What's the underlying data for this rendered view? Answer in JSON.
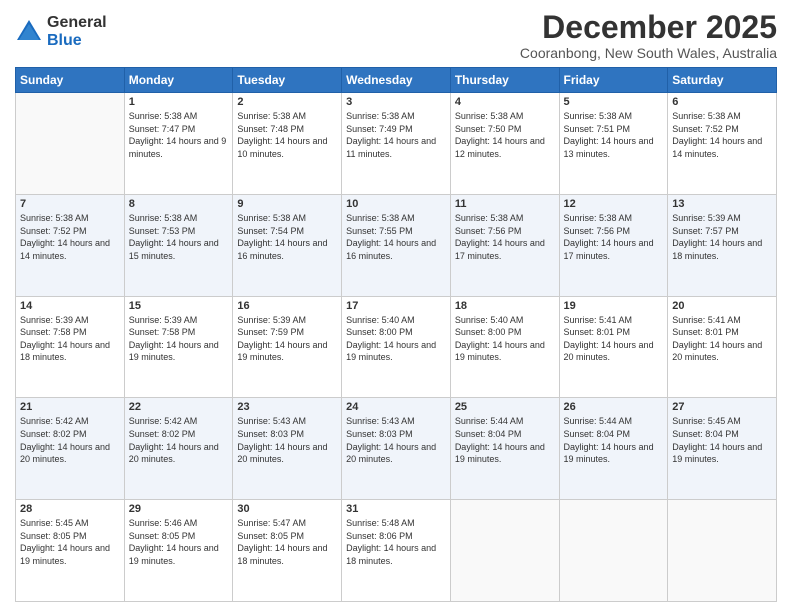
{
  "logo": {
    "general": "General",
    "blue": "Blue"
  },
  "header": {
    "month": "December 2025",
    "location": "Cooranbong, New South Wales, Australia"
  },
  "days_of_week": [
    "Sunday",
    "Monday",
    "Tuesday",
    "Wednesday",
    "Thursday",
    "Friday",
    "Saturday"
  ],
  "weeks": [
    [
      {
        "day": "",
        "sunrise": "",
        "sunset": "",
        "daylight": ""
      },
      {
        "day": "1",
        "sunrise": "Sunrise: 5:38 AM",
        "sunset": "Sunset: 7:47 PM",
        "daylight": "Daylight: 14 hours and 9 minutes."
      },
      {
        "day": "2",
        "sunrise": "Sunrise: 5:38 AM",
        "sunset": "Sunset: 7:48 PM",
        "daylight": "Daylight: 14 hours and 10 minutes."
      },
      {
        "day": "3",
        "sunrise": "Sunrise: 5:38 AM",
        "sunset": "Sunset: 7:49 PM",
        "daylight": "Daylight: 14 hours and 11 minutes."
      },
      {
        "day": "4",
        "sunrise": "Sunrise: 5:38 AM",
        "sunset": "Sunset: 7:50 PM",
        "daylight": "Daylight: 14 hours and 12 minutes."
      },
      {
        "day": "5",
        "sunrise": "Sunrise: 5:38 AM",
        "sunset": "Sunset: 7:51 PM",
        "daylight": "Daylight: 14 hours and 13 minutes."
      },
      {
        "day": "6",
        "sunrise": "Sunrise: 5:38 AM",
        "sunset": "Sunset: 7:52 PM",
        "daylight": "Daylight: 14 hours and 14 minutes."
      }
    ],
    [
      {
        "day": "7",
        "sunrise": "Sunrise: 5:38 AM",
        "sunset": "Sunset: 7:52 PM",
        "daylight": "Daylight: 14 hours and 14 minutes."
      },
      {
        "day": "8",
        "sunrise": "Sunrise: 5:38 AM",
        "sunset": "Sunset: 7:53 PM",
        "daylight": "Daylight: 14 hours and 15 minutes."
      },
      {
        "day": "9",
        "sunrise": "Sunrise: 5:38 AM",
        "sunset": "Sunset: 7:54 PM",
        "daylight": "Daylight: 14 hours and 16 minutes."
      },
      {
        "day": "10",
        "sunrise": "Sunrise: 5:38 AM",
        "sunset": "Sunset: 7:55 PM",
        "daylight": "Daylight: 14 hours and 16 minutes."
      },
      {
        "day": "11",
        "sunrise": "Sunrise: 5:38 AM",
        "sunset": "Sunset: 7:56 PM",
        "daylight": "Daylight: 14 hours and 17 minutes."
      },
      {
        "day": "12",
        "sunrise": "Sunrise: 5:38 AM",
        "sunset": "Sunset: 7:56 PM",
        "daylight": "Daylight: 14 hours and 17 minutes."
      },
      {
        "day": "13",
        "sunrise": "Sunrise: 5:39 AM",
        "sunset": "Sunset: 7:57 PM",
        "daylight": "Daylight: 14 hours and 18 minutes."
      }
    ],
    [
      {
        "day": "14",
        "sunrise": "Sunrise: 5:39 AM",
        "sunset": "Sunset: 7:58 PM",
        "daylight": "Daylight: 14 hours and 18 minutes."
      },
      {
        "day": "15",
        "sunrise": "Sunrise: 5:39 AM",
        "sunset": "Sunset: 7:58 PM",
        "daylight": "Daylight: 14 hours and 19 minutes."
      },
      {
        "day": "16",
        "sunrise": "Sunrise: 5:39 AM",
        "sunset": "Sunset: 7:59 PM",
        "daylight": "Daylight: 14 hours and 19 minutes."
      },
      {
        "day": "17",
        "sunrise": "Sunrise: 5:40 AM",
        "sunset": "Sunset: 8:00 PM",
        "daylight": "Daylight: 14 hours and 19 minutes."
      },
      {
        "day": "18",
        "sunrise": "Sunrise: 5:40 AM",
        "sunset": "Sunset: 8:00 PM",
        "daylight": "Daylight: 14 hours and 19 minutes."
      },
      {
        "day": "19",
        "sunrise": "Sunrise: 5:41 AM",
        "sunset": "Sunset: 8:01 PM",
        "daylight": "Daylight: 14 hours and 20 minutes."
      },
      {
        "day": "20",
        "sunrise": "Sunrise: 5:41 AM",
        "sunset": "Sunset: 8:01 PM",
        "daylight": "Daylight: 14 hours and 20 minutes."
      }
    ],
    [
      {
        "day": "21",
        "sunrise": "Sunrise: 5:42 AM",
        "sunset": "Sunset: 8:02 PM",
        "daylight": "Daylight: 14 hours and 20 minutes."
      },
      {
        "day": "22",
        "sunrise": "Sunrise: 5:42 AM",
        "sunset": "Sunset: 8:02 PM",
        "daylight": "Daylight: 14 hours and 20 minutes."
      },
      {
        "day": "23",
        "sunrise": "Sunrise: 5:43 AM",
        "sunset": "Sunset: 8:03 PM",
        "daylight": "Daylight: 14 hours and 20 minutes."
      },
      {
        "day": "24",
        "sunrise": "Sunrise: 5:43 AM",
        "sunset": "Sunset: 8:03 PM",
        "daylight": "Daylight: 14 hours and 20 minutes."
      },
      {
        "day": "25",
        "sunrise": "Sunrise: 5:44 AM",
        "sunset": "Sunset: 8:04 PM",
        "daylight": "Daylight: 14 hours and 19 minutes."
      },
      {
        "day": "26",
        "sunrise": "Sunrise: 5:44 AM",
        "sunset": "Sunset: 8:04 PM",
        "daylight": "Daylight: 14 hours and 19 minutes."
      },
      {
        "day": "27",
        "sunrise": "Sunrise: 5:45 AM",
        "sunset": "Sunset: 8:04 PM",
        "daylight": "Daylight: 14 hours and 19 minutes."
      }
    ],
    [
      {
        "day": "28",
        "sunrise": "Sunrise: 5:45 AM",
        "sunset": "Sunset: 8:05 PM",
        "daylight": "Daylight: 14 hours and 19 minutes."
      },
      {
        "day": "29",
        "sunrise": "Sunrise: 5:46 AM",
        "sunset": "Sunset: 8:05 PM",
        "daylight": "Daylight: 14 hours and 19 minutes."
      },
      {
        "day": "30",
        "sunrise": "Sunrise: 5:47 AM",
        "sunset": "Sunset: 8:05 PM",
        "daylight": "Daylight: 14 hours and 18 minutes."
      },
      {
        "day": "31",
        "sunrise": "Sunrise: 5:48 AM",
        "sunset": "Sunset: 8:06 PM",
        "daylight": "Daylight: 14 hours and 18 minutes."
      },
      {
        "day": "",
        "sunrise": "",
        "sunset": "",
        "daylight": ""
      },
      {
        "day": "",
        "sunrise": "",
        "sunset": "",
        "daylight": ""
      },
      {
        "day": "",
        "sunrise": "",
        "sunset": "",
        "daylight": ""
      }
    ]
  ]
}
